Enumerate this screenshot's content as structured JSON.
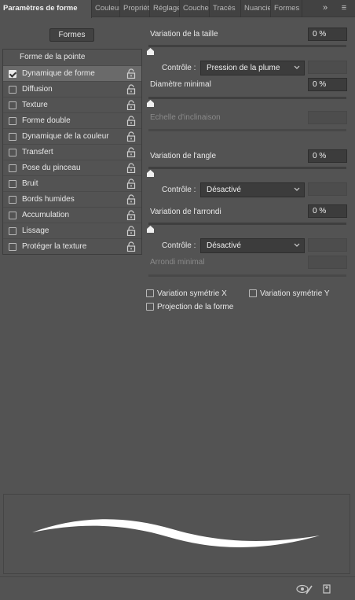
{
  "tabs": [
    {
      "label": "Paramètres de forme",
      "active": true
    },
    {
      "label": "Couleur",
      "active": false
    },
    {
      "label": "Propriétés",
      "active": false
    },
    {
      "label": "Réglages",
      "active": false
    },
    {
      "label": "Couches",
      "active": false
    },
    {
      "label": "Tracés",
      "active": false
    },
    {
      "label": "Nuancier",
      "active": false
    },
    {
      "label": "Formes",
      "active": false
    }
  ],
  "tab_icons": {
    "overflow": "double-chevron-right-icon",
    "menu": "hamburger-menu-icon"
  },
  "formes_button": "Formes",
  "list": {
    "header": "Forme de la pointe",
    "items": [
      {
        "label": "Dynamique de forme",
        "checked": true,
        "selected": true
      },
      {
        "label": "Diffusion",
        "checked": false,
        "selected": false
      },
      {
        "label": "Texture",
        "checked": false,
        "selected": false
      },
      {
        "label": "Forme double",
        "checked": false,
        "selected": false
      },
      {
        "label": "Dynamique de la couleur",
        "checked": false,
        "selected": false
      },
      {
        "label": "Transfert",
        "checked": false,
        "selected": false
      },
      {
        "label": "Pose du pinceau",
        "checked": false,
        "selected": false
      },
      {
        "label": "Bruit",
        "checked": false,
        "selected": false
      },
      {
        "label": "Bords humides",
        "checked": false,
        "selected": false
      },
      {
        "label": "Accumulation",
        "checked": false,
        "selected": false
      },
      {
        "label": "Lissage",
        "checked": false,
        "selected": false
      },
      {
        "label": "Protéger la texture",
        "checked": false,
        "selected": false
      }
    ]
  },
  "settings": {
    "size_jitter": {
      "label": "Variation de la taille",
      "value": "0 %",
      "slider": 0
    },
    "size_control": {
      "label": "Contrôle :",
      "value": "Pression de la plume"
    },
    "min_diameter": {
      "label": "Diamètre minimal",
      "value": "0 %",
      "slider": 0
    },
    "tilt_scale": {
      "label": "Echelle d'inclinaison",
      "value": "",
      "enabled": false
    },
    "angle_jitter": {
      "label": "Variation de l'angle",
      "value": "0 %",
      "slider": 0
    },
    "angle_control": {
      "label": "Contrôle :",
      "value": "Désactivé"
    },
    "roundness_jitter": {
      "label": "Variation de l'arrondi",
      "value": "0 %",
      "slider": 0
    },
    "roundness_control": {
      "label": "Contrôle :",
      "value": "Désactivé"
    },
    "min_roundness": {
      "label": "Arrondi minimal",
      "value": "",
      "enabled": false
    },
    "flip_x": {
      "label": "Variation symétrie X",
      "checked": false
    },
    "flip_y": {
      "label": "Variation symétrie Y",
      "checked": false
    },
    "brush_projection": {
      "label": "Projection de la forme",
      "checked": false
    }
  },
  "bottom_icons": [
    "eye-brush-icon",
    "new-preset-icon"
  ],
  "colors": {
    "panel": "#535353",
    "tabbar": "#424242",
    "field": "#3c3c3c",
    "selected_row": "#6a6a6a"
  }
}
